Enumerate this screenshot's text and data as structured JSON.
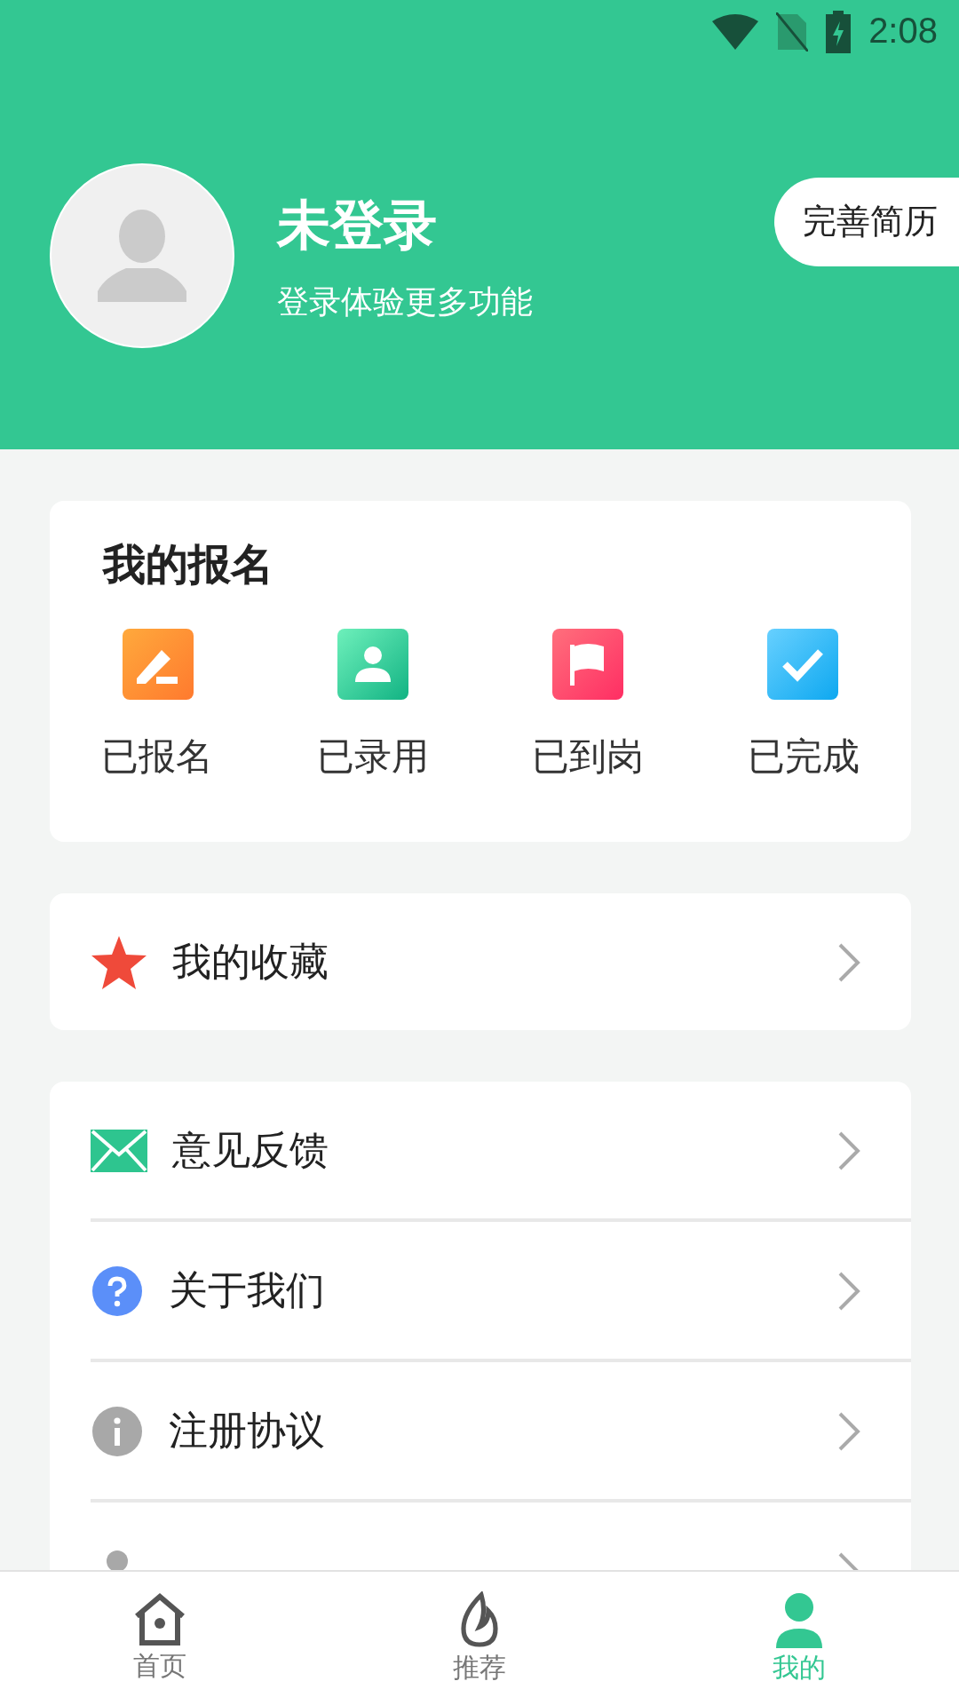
{
  "status_bar": {
    "time": "2:08"
  },
  "profile": {
    "name": "未登录",
    "subtitle": "登录体验更多功能",
    "resume_button": "完善简历"
  },
  "registration": {
    "title": "我的报名",
    "items": [
      {
        "label": "已报名",
        "kind": "signed"
      },
      {
        "label": "已录用",
        "kind": "hired"
      },
      {
        "label": "已到岗",
        "kind": "arrived"
      },
      {
        "label": "已完成",
        "kind": "done"
      }
    ]
  },
  "favorites": [
    {
      "label": "我的收藏",
      "kind": "star"
    }
  ],
  "menu": [
    {
      "label": "意见反馈",
      "kind": "mail"
    },
    {
      "label": "关于我们",
      "kind": "question"
    },
    {
      "label": "注册协议",
      "kind": "info"
    },
    {
      "kind": "person"
    }
  ],
  "tabs": [
    {
      "label": "首页",
      "kind": "home",
      "selected": false
    },
    {
      "label": "推荐",
      "kind": "fire",
      "selected": false
    },
    {
      "label": "我的",
      "kind": "person",
      "selected": true
    }
  ]
}
